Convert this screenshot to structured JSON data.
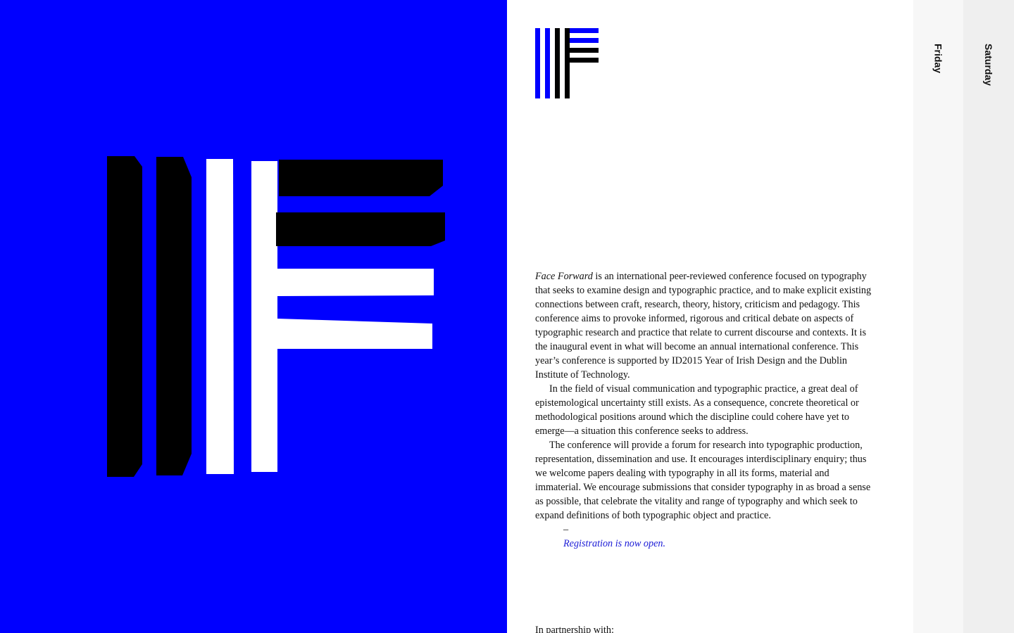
{
  "brand": {
    "logo_name": "face-forward-ff-logo",
    "colors": {
      "blue": "#0000ff",
      "black": "#000000",
      "white": "#ffffff",
      "link": "#1a1ad6"
    }
  },
  "tabs": [
    {
      "label": "Friday"
    },
    {
      "label": "Saturday"
    }
  ],
  "intro": {
    "paragraph1_title": "Face Forward",
    "paragraph1_rest": " is an international peer-reviewed conference focused on typography that seeks to examine design and typographic practice, and to make explicit existing connections between craft, research, theory, history, criticism and pedagogy. This conference aims to provoke informed, rigorous and critical debate on aspects of typographic research and practice that relate to current discourse and contexts. It is the inaugural event in what will become an annual international conference. This year’s conference is supported by ID2015 Year of Irish Design and the Dublin Institute of Technology.",
    "paragraph2": "In the field of visual communication and typographic practice, a great deal of epistemological uncertainty still exists. As a consequence, concrete theoretical or methodological positions around which the discipline could cohere have yet to emerge—a situation this conference seeks to address.",
    "paragraph3": "The conference will provide a forum for research into typographic production, representation, dissemination and use. It encourages interdisciplinary enquiry; thus we welcome papers dealing with typography in all its forms, material and immaterial. We encourage submissions that consider typography in as broad a sense as possible, that celebrate the vitality and range of typography and which seek to expand definitions of both typographic object and practice.",
    "dash": "–",
    "registration": "Registration is now open."
  },
  "partnership_label": "In partnership with:"
}
